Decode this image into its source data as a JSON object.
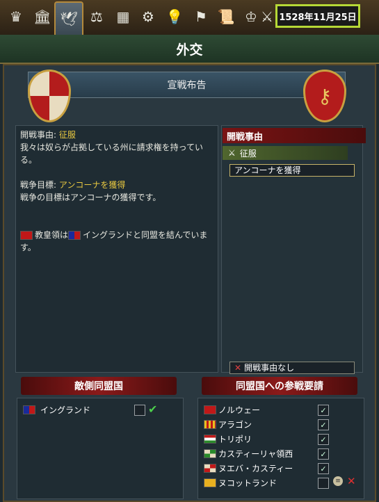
{
  "date": "1528年11月25日",
  "title": "外交",
  "banner": "宣戦布告",
  "tabs": [
    {
      "icon": "crown-icon",
      "glyph": "♛"
    },
    {
      "icon": "court-icon",
      "glyph": "🏛"
    },
    {
      "icon": "dove-icon",
      "glyph": "🕊"
    },
    {
      "icon": "trade-icon",
      "glyph": "⚖"
    },
    {
      "icon": "crate-icon",
      "glyph": "▦"
    },
    {
      "icon": "gears-icon",
      "glyph": "⚙"
    },
    {
      "icon": "lightbulb-icon",
      "glyph": "💡"
    },
    {
      "icon": "flag-icon",
      "glyph": "⚑"
    },
    {
      "icon": "scroll-icon",
      "glyph": "📜"
    },
    {
      "icon": "royal-icon",
      "glyph": "♔"
    },
    {
      "icon": "weapon-icon",
      "glyph": "⚔"
    }
  ],
  "description": {
    "cb_label": "開戦事由: ",
    "cb_value": "征服",
    "cb_text": "我々は奴らが占拠している州に請求権を持っている。",
    "goal_label": "戦争目標: ",
    "goal_value": "アンコーナを獲得",
    "goal_text": "戦争の目標はアンコーナの獲得です。",
    "alliance_a": "教皇領は",
    "alliance_b": "イングランドと同盟を結んでいます。"
  },
  "cb_panel": {
    "header": "開戦事由",
    "selected_cb": "征服",
    "war_goal": "アンコーナを獲得",
    "no_cb": "開戦事由なし"
  },
  "enemy_allies": {
    "header": "敵側同盟国",
    "items": [
      "イングランド"
    ]
  },
  "call_allies": {
    "header": "同盟国への参戦要請",
    "items": [
      "ノルウェー",
      "アラゴン",
      "トリポリ",
      "カスティーリャ領西",
      "ヌエバ・カスティー",
      "ヌコットランド"
    ]
  },
  "colors": {
    "accent": "#b6d836",
    "header_red": "#8a1a1a"
  }
}
